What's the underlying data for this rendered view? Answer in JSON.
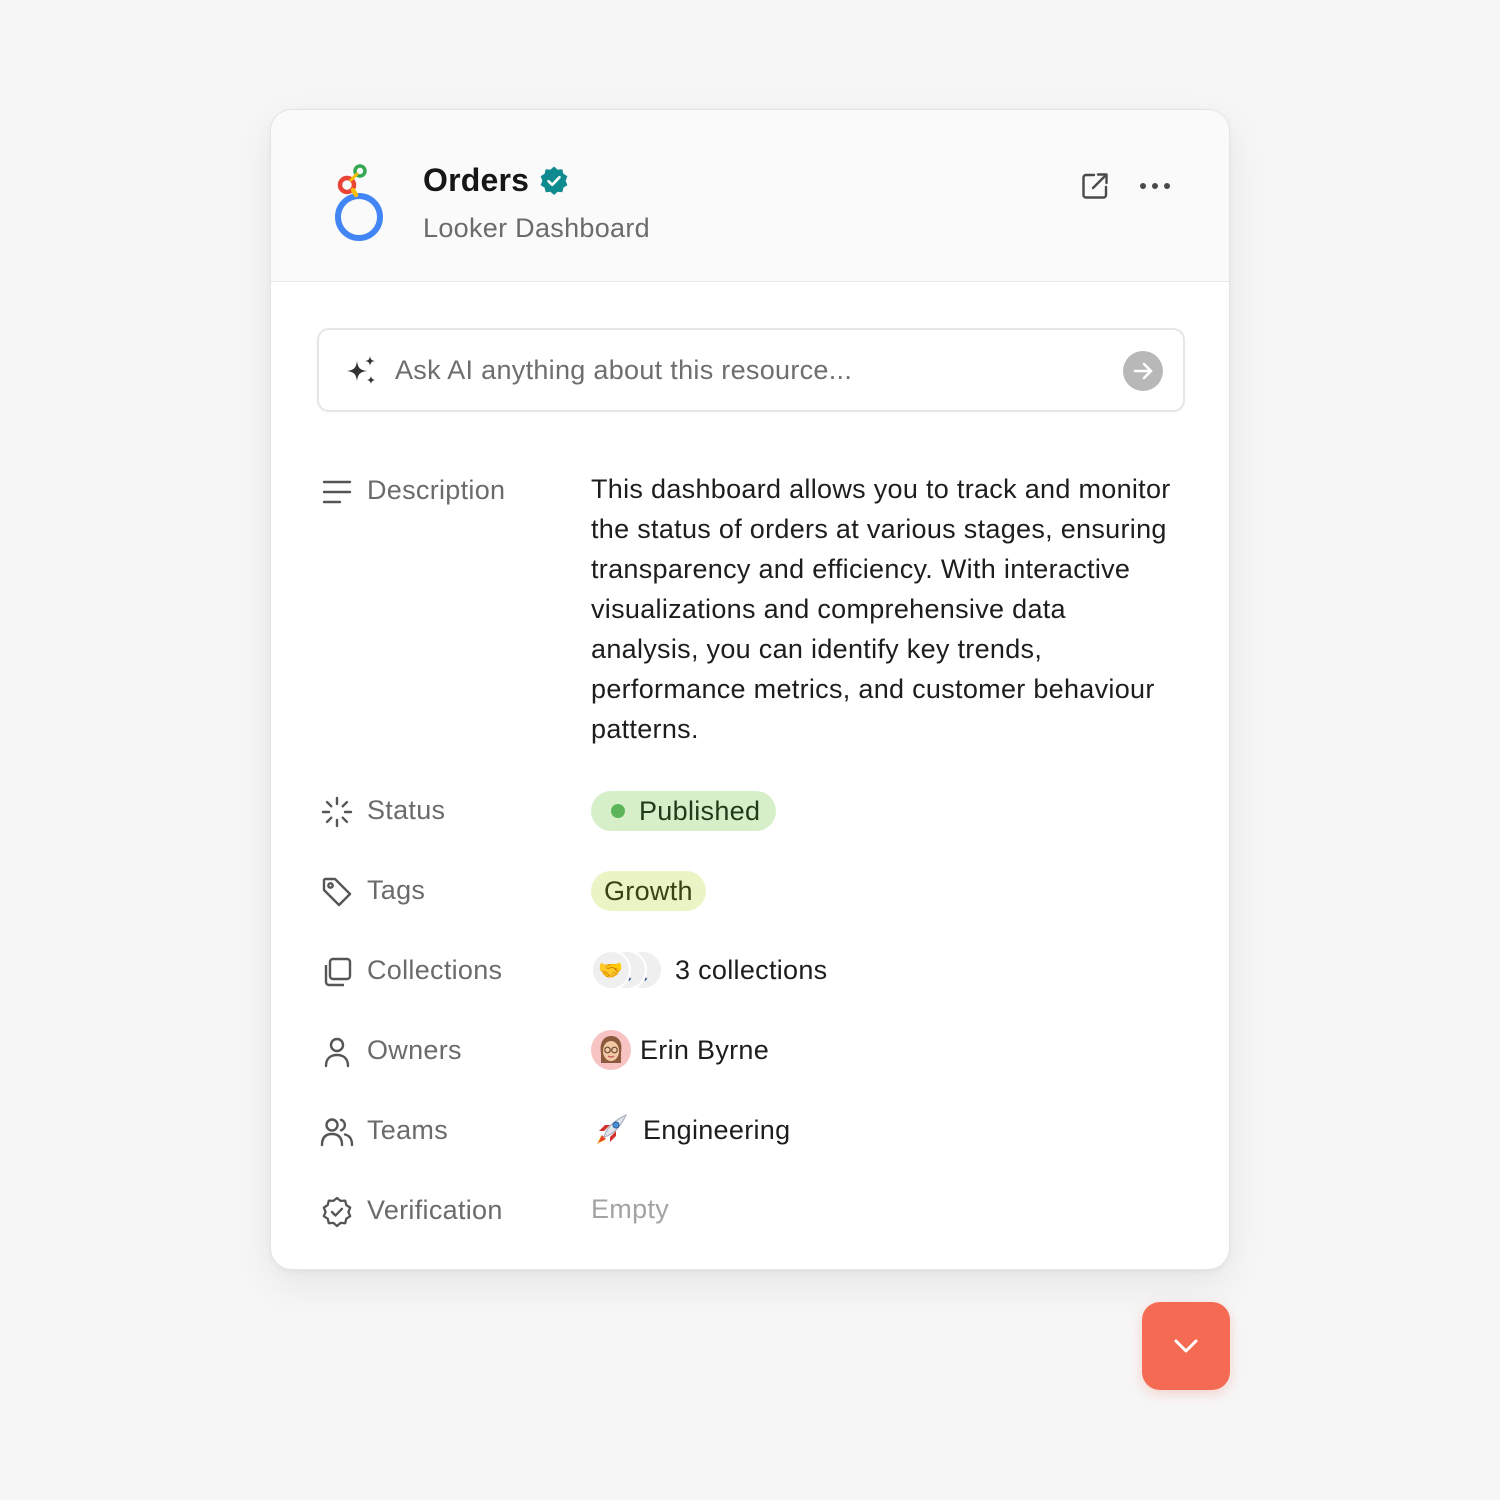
{
  "resource": {
    "title": "Orders",
    "subtitle": "Looker Dashboard",
    "logo_icon": "looker-logo-icon",
    "verified_icon": "verified-badge-icon"
  },
  "header_actions": {
    "open_icon": "external-link-icon",
    "more_icon": "more-horizontal-icon"
  },
  "ask_ai": {
    "placeholder": "Ask AI anything about this resource...",
    "value": "",
    "icon": "sparkle-icon",
    "submit_icon": "arrow-right-icon"
  },
  "properties": {
    "description": {
      "label": "Description",
      "icon": "lines-icon",
      "value": "This dashboard allows you to track and monitor the status of orders at various stages, ensuring transparency and efficiency. With interactive visualizations and comprehensive data analysis, you can identify key trends, performance metrics, and customer behaviour patterns."
    },
    "status": {
      "label": "Status",
      "icon": "loader-icon",
      "value": "Published",
      "color": "#5db55a"
    },
    "tags": {
      "label": "Tags",
      "icon": "tag-icon",
      "value": "Growth"
    },
    "collections": {
      "label": "Collections",
      "icon": "collections-icon",
      "value": "3 collections",
      "emojis": [
        "🤝",
        "🚶",
        "🚶"
      ]
    },
    "owners": {
      "label": "Owners",
      "icon": "user-icon",
      "value": "Erin Byrne"
    },
    "teams": {
      "label": "Teams",
      "icon": "users-icon",
      "value": "Engineering",
      "emoji": "🚀"
    },
    "verification": {
      "label": "Verification",
      "icon": "verification-icon",
      "value": "Empty"
    }
  },
  "fab": {
    "icon": "chevron-down-icon",
    "color": "#f46a53"
  }
}
